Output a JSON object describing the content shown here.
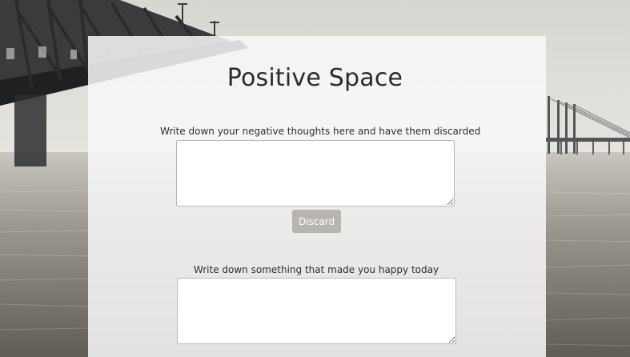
{
  "page": {
    "title": "Positive Space"
  },
  "negative_section": {
    "label": "Write down your negative thoughts here and have them discarded",
    "value": "",
    "placeholder": "",
    "discard_label": "Discard"
  },
  "happy_section": {
    "label": "Write down something that made you happy today",
    "value": "",
    "placeholder": ""
  },
  "colors": {
    "panel_background": "#f8f8f8",
    "button_background": "#b8b4ae",
    "text": "#2b2b2b"
  },
  "background": {
    "depicts": "bridge over water"
  }
}
